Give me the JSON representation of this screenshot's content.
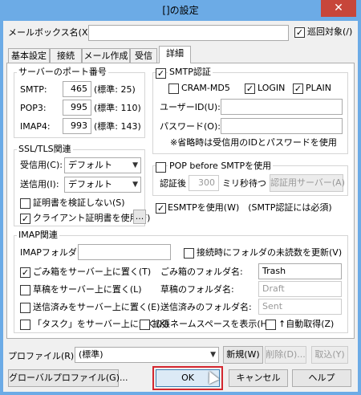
{
  "window": {
    "title": "[]の設定",
    "close_glyph": "✕"
  },
  "top": {
    "mailbox_label": "メールボックス名(X):",
    "mailbox_value": "",
    "patrol_label": "巡回対象(/)",
    "patrol_checked": true
  },
  "tabs": [
    {
      "label": "基本設定",
      "active": false
    },
    {
      "label": "接続",
      "active": false
    },
    {
      "label": "メール作成",
      "active": false
    },
    {
      "label": "受信",
      "active": false
    },
    {
      "label": "詳細",
      "active": true
    }
  ],
  "ports": {
    "title": "サーバーのポート番号",
    "rows": [
      {
        "label": "SMTP:",
        "value": "465",
        "std": "(標準: 25)"
      },
      {
        "label": "POP3:",
        "value": "995",
        "std": "(標準: 110)"
      },
      {
        "label": "IMAP4:",
        "value": "993",
        "std": "(標準: 143)"
      }
    ]
  },
  "ssl": {
    "title": "SSL/TLS関連",
    "recv_label": "受信用(C):",
    "recv_value": "デフォルト",
    "send_label": "送信用(I):",
    "send_value": "デフォルト",
    "verify_label": "証明書を検証しない(S)",
    "verify_checked": false,
    "client_label": "クライアント証明書を使用(F)",
    "client_checked": true,
    "browse_label": "..."
  },
  "smtp_auth": {
    "title": "SMTP認証",
    "checked": true,
    "cram_label": "CRAM-MD5",
    "cram_checked": false,
    "login_label": "LOGIN",
    "login_checked": true,
    "plain_label": "PLAIN",
    "plain_checked": true,
    "userid_label": "ユーザーID(U):",
    "userid_value": "",
    "password_label": "パスワード(O):",
    "password_value": "",
    "note": "※省略時は受信用のIDとパスワードを使用"
  },
  "pop_before": {
    "title": "POP before SMTPを使用",
    "checked": false,
    "after_label": "認証後",
    "after_value": "300",
    "wait_label": "ミリ秒待つ",
    "server_button": "認証用サーバー(A)"
  },
  "esmtp": {
    "label": "ESMTPを使用(W)　(SMTP認証には必須)",
    "checked": true
  },
  "imap": {
    "title": "IMAP関連",
    "folder_label": "IMAPフォルダ:",
    "folder_value": "",
    "unread_label": "接続時にフォルダの未読数を更新(V)",
    "unread_checked": false,
    "trash_label": "ごみ箱をサーバー上に置く(T)",
    "trash_checked": true,
    "trash_folder_label": "ごみ箱のフォルダ名:",
    "trash_folder_value": "Trash",
    "draft_label": "草稿をサーバー上に置く(L)",
    "draft_checked": false,
    "draft_folder_label": "草稿のフォルダ名:",
    "draft_folder_value": "Draft",
    "sent_label": "送信済みをサーバー上に置く(E)",
    "sent_checked": false,
    "sent_folder_label": "送信済みのフォルダ名:",
    "sent_folder_value": "Sent",
    "task_label": "「タスク」をサーバー上に置く(K)",
    "task_checked": false,
    "ns_label": "拡張ネームスペースを表示(H)",
    "ns_checked": false,
    "auto_label": "↑自動取得(Z)",
    "auto_checked": false
  },
  "profile": {
    "label": "プロファイル(R):",
    "value": "(標準)",
    "new_button": "新規(W)",
    "delete_button": "削除(D)...",
    "cancel_button": "取込(Y)"
  },
  "footer": {
    "global_button": "グローバルプロファイル(G)...",
    "ok_button": "OK",
    "cancel_button": "キャンセル",
    "help_button": "ヘルプ"
  },
  "check_glyph": "✓"
}
